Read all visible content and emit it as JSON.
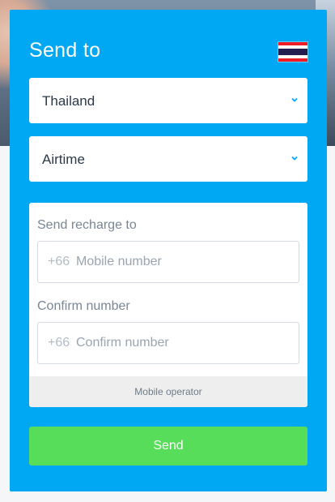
{
  "header": {
    "title": "Send to",
    "flag_icon": "thailand-flag-icon",
    "flag_colors": [
      "#ed1c24",
      "#ffffff",
      "#241d4f",
      "#ffffff",
      "#ed1c24"
    ]
  },
  "country_select": {
    "value": "Thailand",
    "icon": "chevron-down-icon"
  },
  "product_select": {
    "value": "Airtime",
    "icon": "chevron-down-icon"
  },
  "recharge_form": {
    "send_to_label": "Send recharge to",
    "phone_prefix": "+66",
    "mobile_placeholder": "Mobile number",
    "confirm_label": "Confirm number",
    "confirm_prefix": "+66",
    "confirm_placeholder": "Confirm number",
    "operator_label": "Mobile operator"
  },
  "send_button": {
    "label": "Send"
  },
  "colors": {
    "card_bg": "#00a8f4",
    "button_bg": "#58dd5a",
    "chevron": "#00a8f4"
  }
}
